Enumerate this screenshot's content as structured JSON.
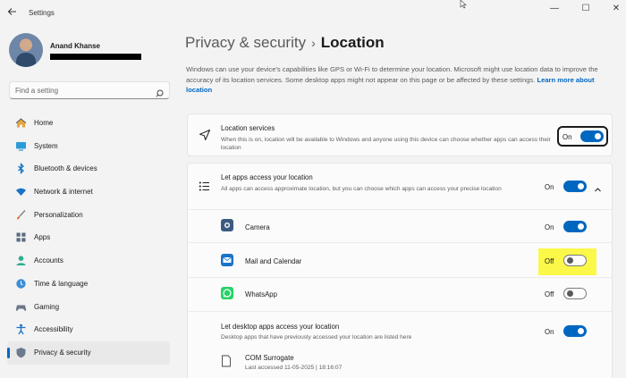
{
  "window": {
    "title": "Settings",
    "back_icon": "back-arrow-icon",
    "minimize": "—",
    "maximize": "☐",
    "close": "✕"
  },
  "profile": {
    "name": "Anand Khanse"
  },
  "search": {
    "placeholder": "Find a setting"
  },
  "nav": {
    "items": [
      {
        "label": "Home",
        "icon": "home-icon"
      },
      {
        "label": "System",
        "icon": "system-icon"
      },
      {
        "label": "Bluetooth & devices",
        "icon": "bluetooth-icon"
      },
      {
        "label": "Network & internet",
        "icon": "network-icon"
      },
      {
        "label": "Personalization",
        "icon": "brush-icon"
      },
      {
        "label": "Apps",
        "icon": "apps-icon"
      },
      {
        "label": "Accounts",
        "icon": "accounts-icon"
      },
      {
        "label": "Time & language",
        "icon": "globe-clock-icon"
      },
      {
        "label": "Gaming",
        "icon": "gaming-icon"
      },
      {
        "label": "Accessibility",
        "icon": "accessibility-icon"
      },
      {
        "label": "Privacy & security",
        "icon": "shield-icon",
        "active": true
      }
    ]
  },
  "page": {
    "breadcrumb_parent": "Privacy & security",
    "breadcrumb_sep": "›",
    "breadcrumb_current": "Location",
    "intro": "Windows can use your device's capabilities like GPS or Wi-Fi to determine your location. Microsoft might use location data to improve the accuracy of its location services. Some desktop apps might not appear on this page or be affected by these settings.",
    "learn_more": "Learn more about location"
  },
  "location_services": {
    "title": "Location services",
    "desc": "When this is on, location will be available to Windows and anyone using this device can choose whether apps can access their location",
    "state": "On",
    "on": true
  },
  "apps_access": {
    "title": "Let apps access your location",
    "desc": "All apps can access approximate location, but you can choose which apps can access your precise location",
    "state": "On",
    "on": true,
    "expanded": true
  },
  "apps": [
    {
      "name": "Camera",
      "state": "On",
      "on": true,
      "icon": "camera-app-icon"
    },
    {
      "name": "Mail and Calendar",
      "state": "Off",
      "on": false,
      "icon": "mail-app-icon"
    },
    {
      "name": "WhatsApp",
      "state": "Off",
      "on": false,
      "icon": "whatsapp-app-icon"
    }
  ],
  "desktop_apps": {
    "title": "Let desktop apps access your location",
    "desc": "Desktop apps that have previously accessed your location are listed here",
    "state": "On",
    "on": true
  },
  "desktop_app_list": [
    {
      "name": "COM Surrogate",
      "last_accessed": "Last accessed 11-05-2025  |  18:16:07",
      "icon": "document-icon"
    }
  ],
  "colors": {
    "accent": "#0067c0",
    "highlight": "#fbf84a"
  }
}
